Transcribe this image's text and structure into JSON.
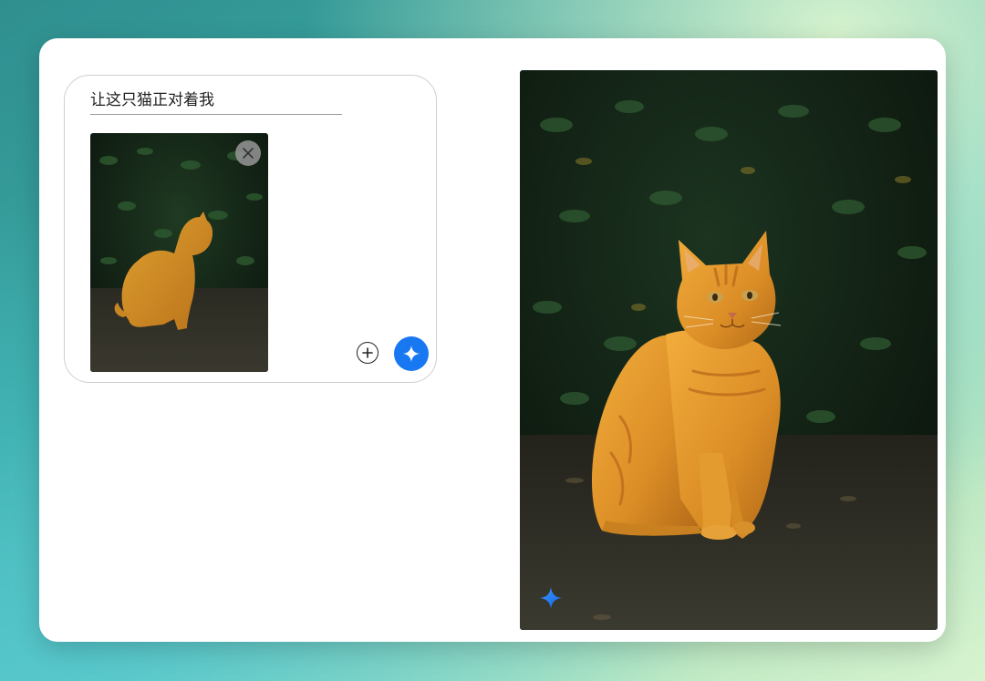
{
  "composer": {
    "prompt_text": "让这只猫正对着我",
    "attachment_icon": "cat-photo-thumbnail",
    "remove_icon": "close-icon",
    "add_icon": "plus-circle-icon",
    "send_icon": "sparkle-icon"
  },
  "result": {
    "image_icon": "cat-facing-camera-image",
    "badge_icon": "sparkle-icon"
  },
  "colors": {
    "accent": "#1878f2",
    "card_background": "#ffffff",
    "border": "#cfcfcf"
  }
}
